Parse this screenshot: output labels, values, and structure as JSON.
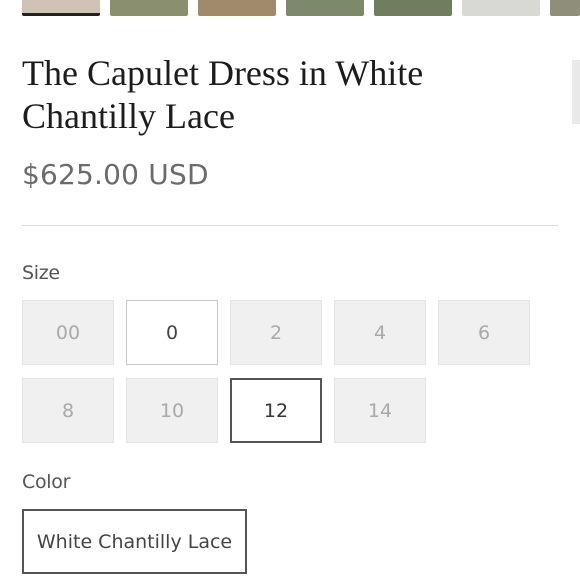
{
  "product": {
    "title": "The Capulet Dress in White Chantilly Lace",
    "price": "$625.00 USD"
  },
  "thumbnails": [
    {
      "name": "thumbnail-1",
      "selected": true,
      "color": "#cfc4b4"
    },
    {
      "name": "thumbnail-2",
      "selected": false,
      "color": "#8a8f6f"
    },
    {
      "name": "thumbnail-3",
      "selected": false,
      "color": "#a08a6c"
    },
    {
      "name": "thumbnail-4",
      "selected": false,
      "color": "#7d8a6a"
    },
    {
      "name": "thumbnail-5",
      "selected": false,
      "color": "#6f7e5c"
    },
    {
      "name": "thumbnail-6",
      "selected": false,
      "color": "#d8d8d4"
    },
    {
      "name": "thumbnail-7",
      "selected": false,
      "color": "#8e8e7a"
    }
  ],
  "size": {
    "label": "Size",
    "options": [
      {
        "label": "00",
        "state": "unavailable"
      },
      {
        "label": "0",
        "state": "available"
      },
      {
        "label": "2",
        "state": "unavailable"
      },
      {
        "label": "4",
        "state": "unavailable"
      },
      {
        "label": "6",
        "state": "unavailable"
      },
      {
        "label": "8",
        "state": "unavailable"
      },
      {
        "label": "10",
        "state": "unavailable"
      },
      {
        "label": "12",
        "state": "selected"
      },
      {
        "label": "14",
        "state": "unavailable"
      }
    ]
  },
  "color": {
    "label": "Color",
    "selected": "White Chantilly Lace"
  }
}
